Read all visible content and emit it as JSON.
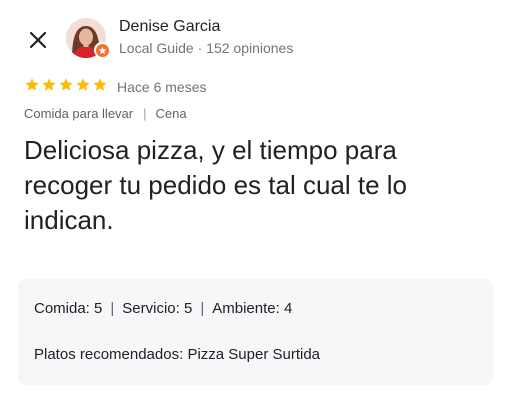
{
  "header": {
    "close_icon": "close-icon",
    "reviewer_name": "Denise Garcia",
    "reviewer_meta": "Local Guide · 152 opiniones",
    "badge_color": "#f4722b"
  },
  "review": {
    "rating": 5,
    "max_rating": 5,
    "star_color": "#fbbc04",
    "time_ago": "Hace 6 meses",
    "tags": [
      "Comida para llevar",
      "Cena"
    ],
    "text": "Deliciosa pizza, y el tiempo para recoger tu pedido es tal cual te lo indican."
  },
  "ratings": {
    "food_label": "Comida:",
    "food_value": "5",
    "service_label": "Servicio:",
    "service_value": "5",
    "ambience_label": "Ambiente:",
    "ambience_value": "4",
    "dishes_label": "Platos recomendados:",
    "dishes_value": "Pizza Super Surtida"
  }
}
